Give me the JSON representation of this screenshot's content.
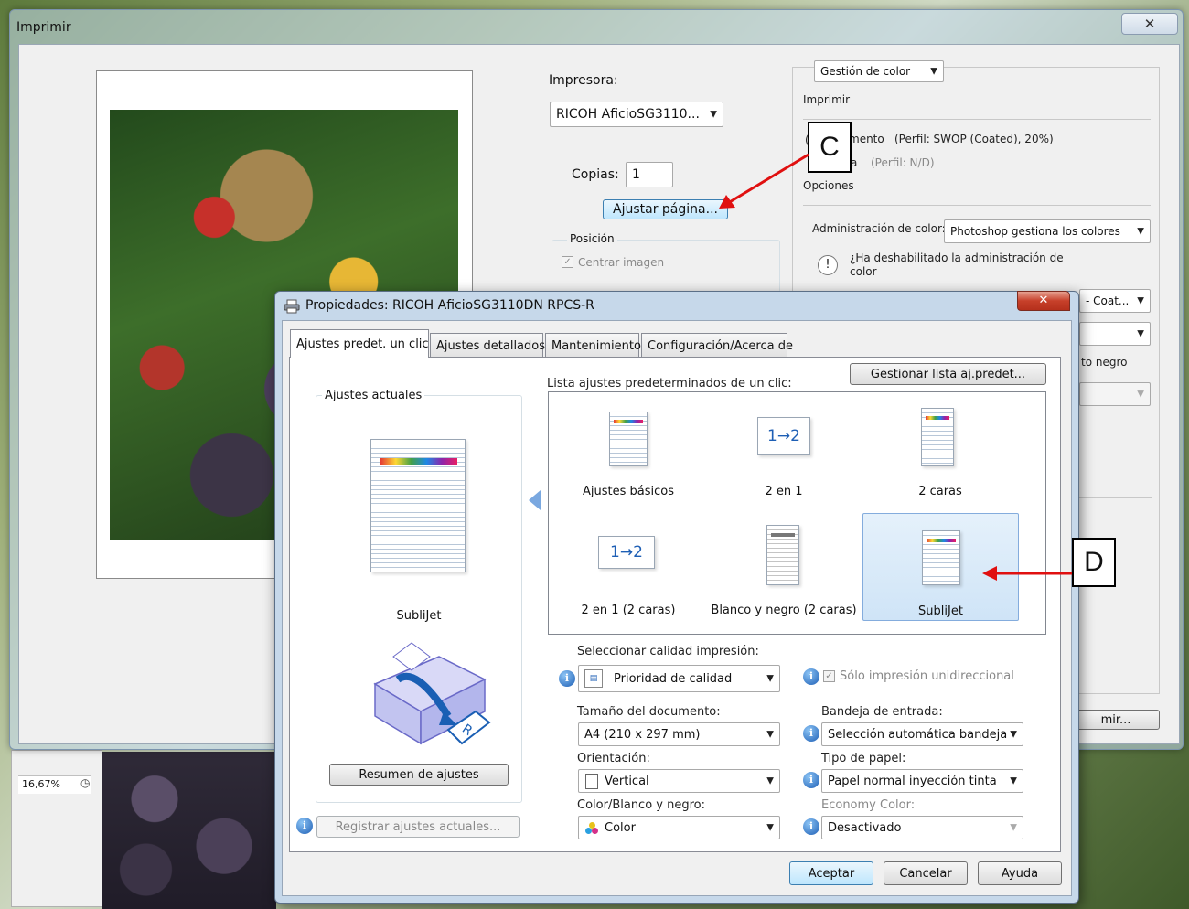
{
  "print_window": {
    "title": "Imprimir",
    "close": "✕",
    "printer_label": "Impresora:",
    "printer_value": "RICOH AficioSG3110...",
    "copies_label": "Copias:",
    "copies_value": "1",
    "page_setup_button": "Ajustar página...",
    "position_legend": "Posición",
    "center_image": "Centrar imagen",
    "color_mgmt_dropdown": "Gestión de color",
    "print_section": "Imprimir",
    "documento_prefix": "( ",
    "documento_text": "mento",
    "documento_profile": "(Perfil: SWOP (Coated), 20%)",
    "prueba_text": "a",
    "prueba_profile": "(Perfil: N/D)",
    "options_section": "Opciones",
    "color_handling_label": "Administración de color:",
    "color_handling_value": "Photoshop gestiona los colores",
    "warning_text_1": "¿Ha deshabilitado la administración de",
    "warning_text_2": "color",
    "profile_value_partial": "- Coat...",
    "black_point_partial": "to negro",
    "print_button_partial": "mir...",
    "zoom": "16,67%"
  },
  "props": {
    "title": "Propiedades: RICOH AficioSG3110DN RPCS-R",
    "close": "✕",
    "tabs": [
      "Ajustes predet. un clic",
      "Ajustes detallados",
      "Mantenimiento",
      "Configuración/Acerca de"
    ],
    "current_settings_legend": "Ajustes actuales",
    "current_settings_name": "SubliJet",
    "summary_button": "Resumen de ajustes",
    "register_button": "Registrar ajustes actuales...",
    "manage_button": "Gestionar lista aj.predet...",
    "list_label": "Lista ajustes predeterminados de un clic:",
    "presets": [
      "Ajustes básicos",
      "2 en 1",
      "2 caras",
      "2 en 1 (2 caras)",
      "Blanco y negro (2 caras)",
      "SubliJet"
    ],
    "preset_2in1_glyph": "1→2",
    "quality_label": "Seleccionar calidad impresión:",
    "quality_value": "Prioridad de calidad",
    "unidirectional_label": "Sólo impresión unidireccional",
    "doc_size_label": "Tamaño del documento:",
    "doc_size_value": "A4 (210 x 297 mm)",
    "input_tray_label": "Bandeja de entrada:",
    "input_tray_value": "Selección automática bandeja",
    "orientation_label": "Orientación:",
    "orientation_value": "Vertical",
    "paper_type_label": "Tipo de papel:",
    "paper_type_value": "Papel normal inyección tinta",
    "color_bw_label": "Color/Blanco y negro:",
    "color_bw_value": "Color",
    "economy_label": "Economy Color:",
    "economy_value": "Desactivado",
    "ok": "Aceptar",
    "cancel": "Cancelar",
    "help": "Ayuda"
  },
  "callouts": {
    "c": "C",
    "d": "D"
  },
  "colors": {
    "arrow": "#e01010",
    "selection": "#cfe4f7"
  }
}
